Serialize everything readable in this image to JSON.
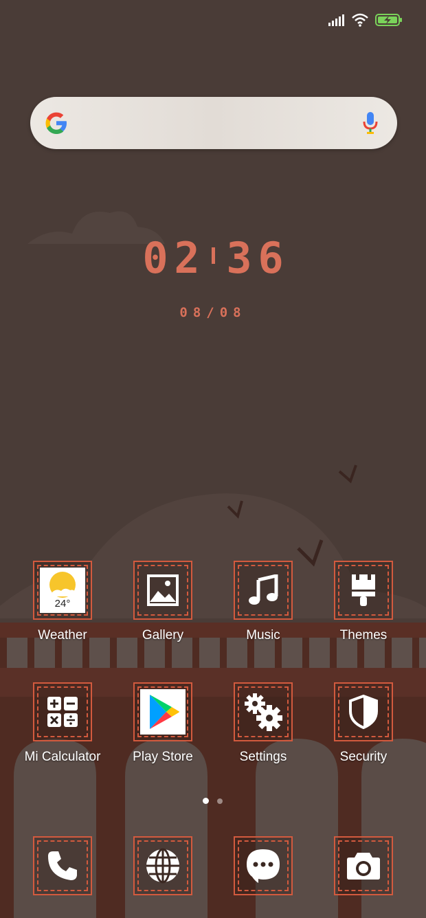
{
  "status_bar": {
    "signal_icon": "signal-bars-icon",
    "wifi_icon": "wifi-icon",
    "battery_icon": "battery-charging-icon",
    "battery_color": "#7ad35a"
  },
  "search": {
    "logo": "google-g-icon",
    "voice_icon": "microphone-icon",
    "placeholder": ""
  },
  "clock": {
    "h1": "0",
    "h2": "2",
    "m1": "3",
    "m2": "6",
    "date": "08/08",
    "color": "#d9715a"
  },
  "apps_row1": [
    {
      "label": "Weather",
      "icon": "weather-icon",
      "temp": "24°"
    },
    {
      "label": "Gallery",
      "icon": "gallery-icon"
    },
    {
      "label": "Music",
      "icon": "music-note-icon"
    },
    {
      "label": "Themes",
      "icon": "paintbrush-icon"
    }
  ],
  "apps_row2": [
    {
      "label": "Mi Calculator",
      "icon": "calculator-icon"
    },
    {
      "label": "Play Store",
      "icon": "play-store-icon"
    },
    {
      "label": "Settings",
      "icon": "gears-icon"
    },
    {
      "label": "Security",
      "icon": "shield-icon"
    }
  ],
  "page_indicator": {
    "pages": 2,
    "active": 1
  },
  "dock": [
    {
      "icon": "phone-icon"
    },
    {
      "icon": "browser-globe-icon"
    },
    {
      "icon": "messages-icon"
    },
    {
      "icon": "camera-icon"
    }
  ],
  "accent_color": "#d35a3e"
}
